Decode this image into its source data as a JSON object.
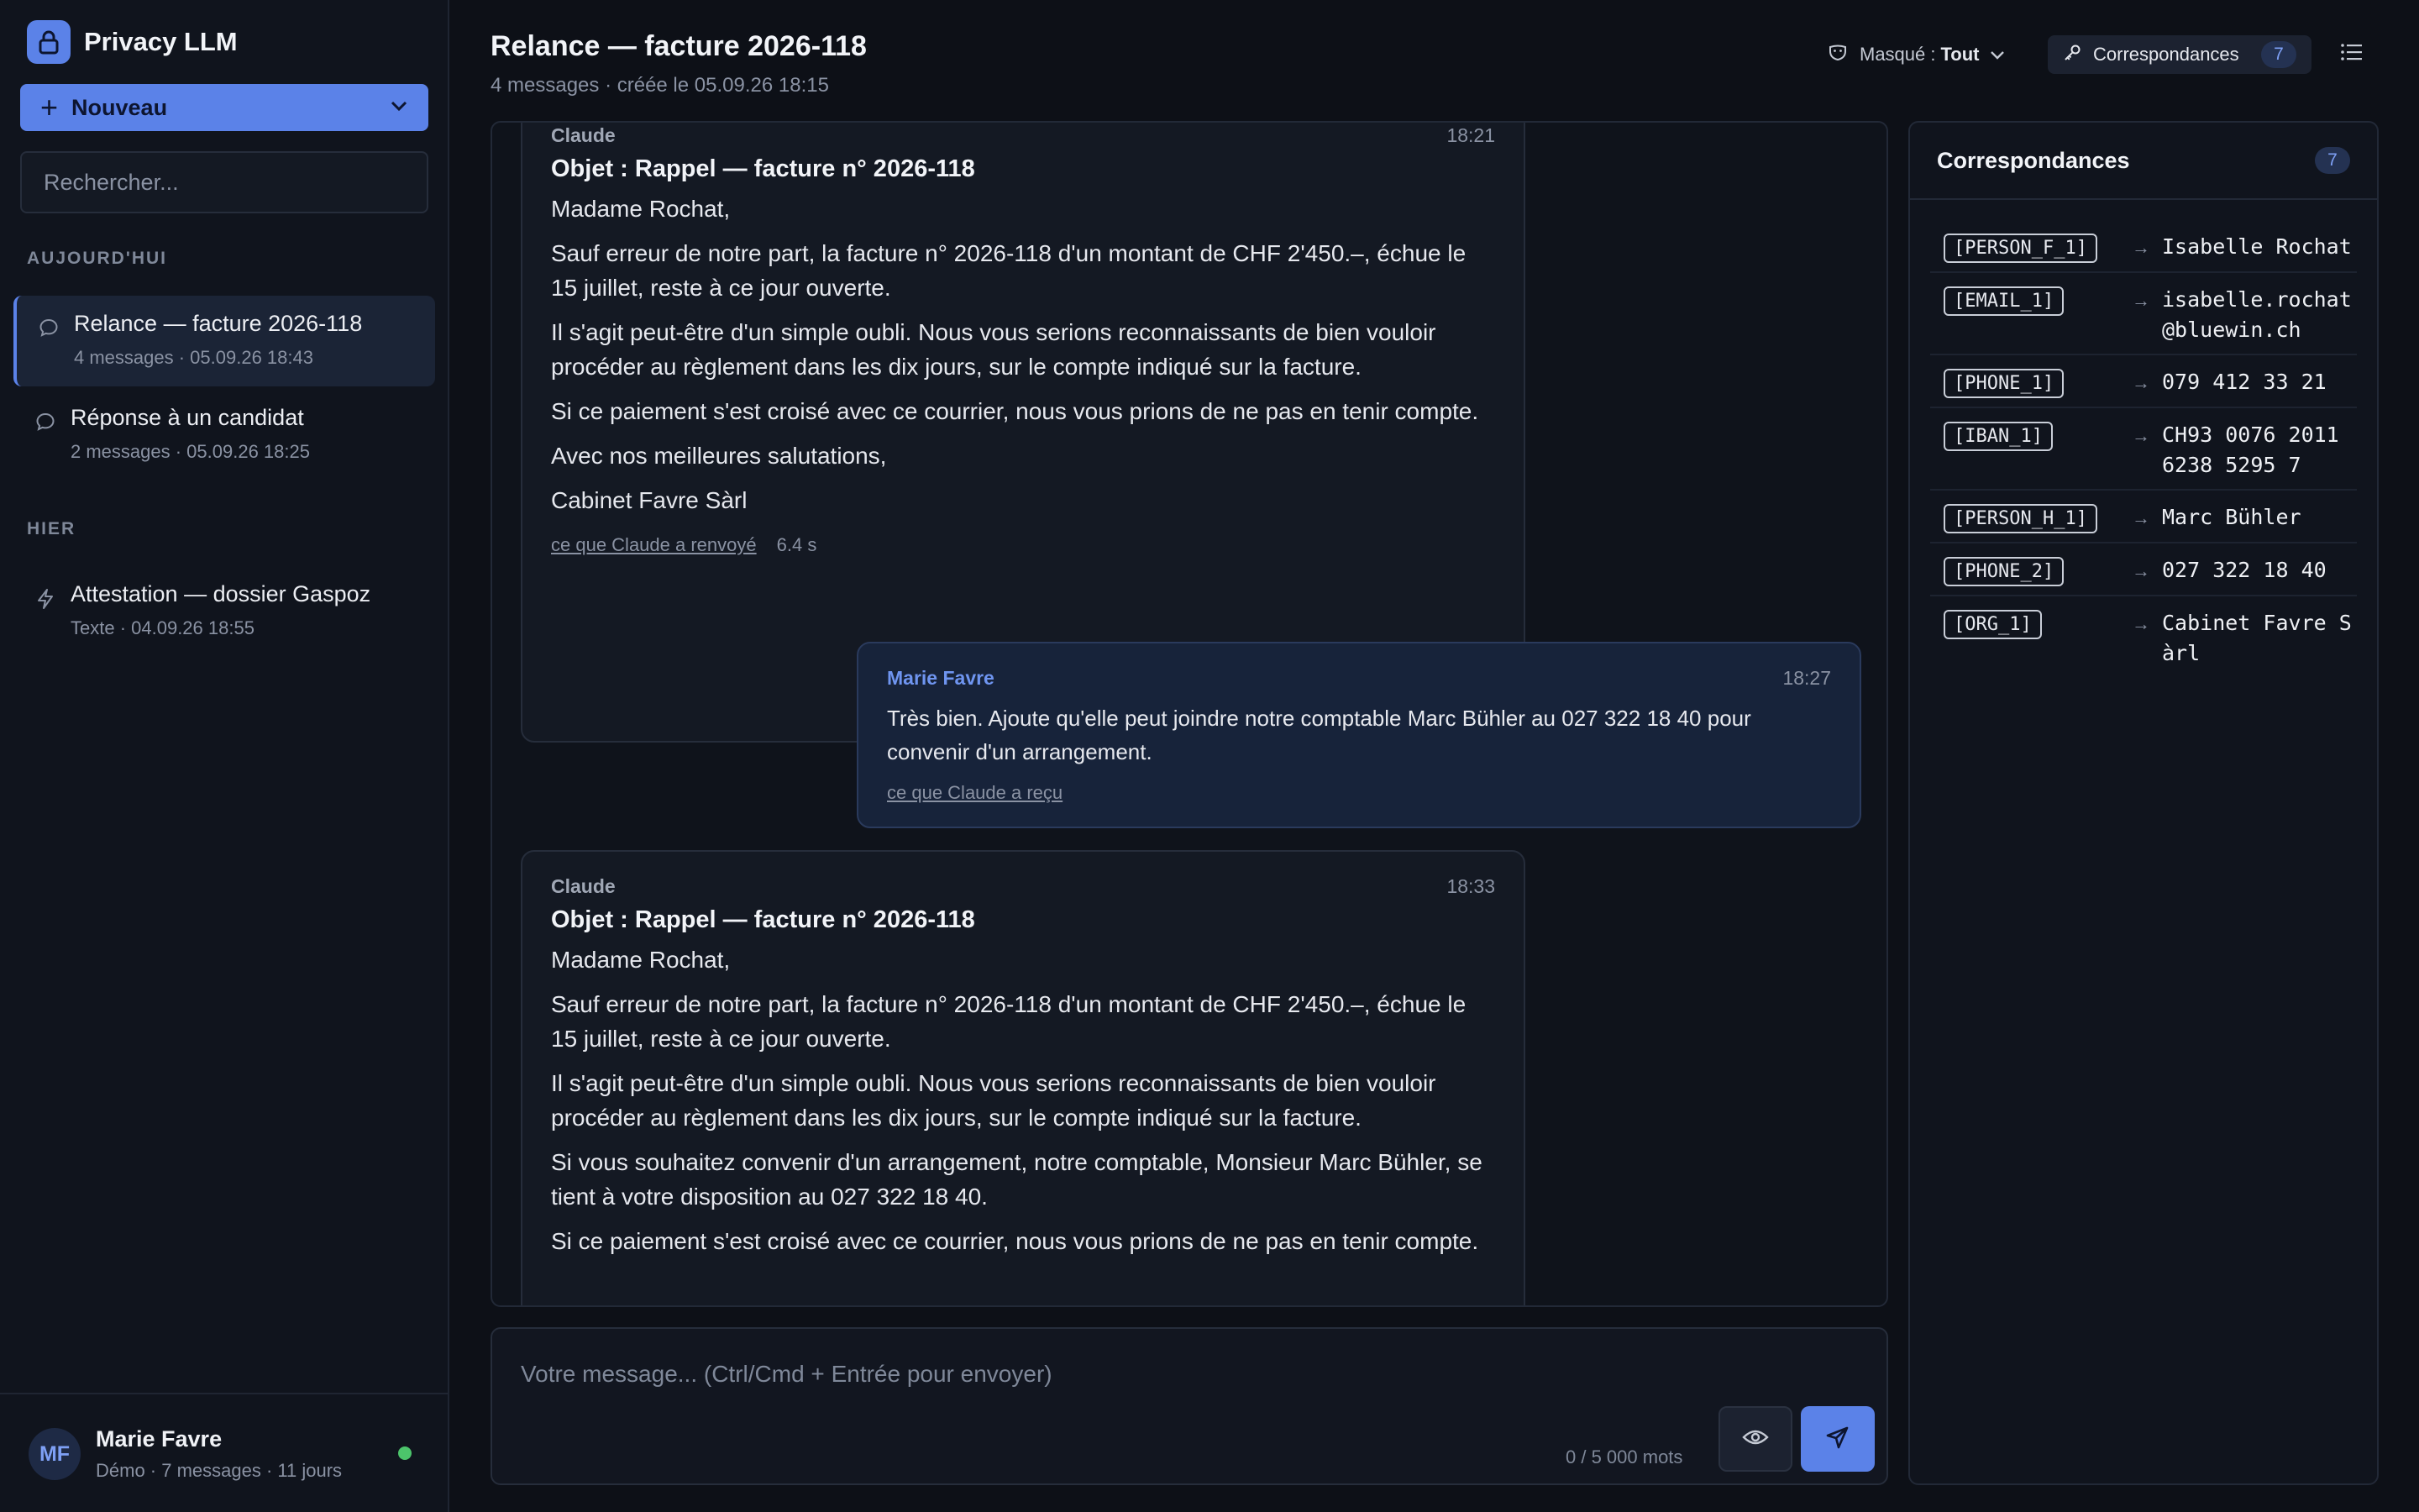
{
  "app": {
    "name": "Privacy LLM"
  },
  "sidebar": {
    "new_label": "Nouveau",
    "search_placeholder": "Rechercher...",
    "sections": {
      "today": "AUJOURD'HUI",
      "yesterday": "HIER"
    },
    "conversations": [
      {
        "title": "Relance — facture 2026-118",
        "meta": "4 messages · 05.09.26 18:43",
        "active": true,
        "icon": "chat-bubble-icon"
      },
      {
        "title": "Réponse à un candidat",
        "meta": "2 messages · 05.09.26 18:25",
        "active": false,
        "icon": "chat-bubble-icon"
      },
      {
        "title": "Attestation — dossier Gaspoz",
        "meta": "Texte · 04.09.26 18:55",
        "active": false,
        "icon": "lightning-icon"
      }
    ],
    "user": {
      "initials": "MF",
      "name": "Marie Favre",
      "meta": "Démo · 7 messages · 11 jours",
      "status_color": "#4cc46b"
    }
  },
  "header": {
    "title": "Relance — facture 2026-118",
    "subtitle": "4 messages · créée le 05.09.26 18:15",
    "mask_label": "Masqué :",
    "mask_value": "Tout",
    "correspondences_label": "Correspondances",
    "correspondences_count": "7"
  },
  "messages": [
    {
      "role": "assistant",
      "author": "Claude",
      "time": "18:21",
      "subject": "Objet : Rappel — facture n° 2026-118",
      "paragraphs": [
        "Madame Rochat,",
        "Sauf erreur de notre part, la facture n° 2026-118 d'un montant de CHF 2'450.–, échue le 15 juillet, reste à ce jour ouverte.",
        "Il s'agit peut-être d'un simple oubli. Nous vous serions reconnaissants de bien vouloir procéder au règlement dans les dix jours, sur le compte indiqué sur la facture.",
        "Si ce paiement s'est croisé avec ce courrier, nous vous prions de ne pas en tenir compte.",
        "Avec nos meilleures salutations,",
        "Cabinet Favre Sàrl"
      ],
      "footer_link": "ce que Claude a renvoyé",
      "duration": "6.4 s"
    },
    {
      "role": "user",
      "author": "Marie Favre",
      "time": "18:27",
      "paragraphs": [
        "Très bien. Ajoute qu'elle peut joindre notre comptable Marc Bühler au 027 322 18 40 pour convenir d'un arrangement."
      ],
      "footer_link": "ce que Claude a reçu"
    },
    {
      "role": "assistant",
      "author": "Claude",
      "time": "18:33",
      "subject": "Objet : Rappel — facture n° 2026-118",
      "paragraphs": [
        "Madame Rochat,",
        "Sauf erreur de notre part, la facture n° 2026-118 d'un montant de CHF 2'450.–, échue le 15 juillet, reste à ce jour ouverte.",
        "Il s'agit peut-être d'un simple oubli. Nous vous serions reconnaissants de bien vouloir procéder au règlement dans les dix jours, sur le compte indiqué sur la facture.",
        "Si vous souhaitez convenir d'un arrangement, notre comptable, Monsieur Marc Bühler, se tient à votre disposition au 027 322 18 40.",
        "Si ce paiement s'est croisé avec ce courrier, nous vous prions de ne pas en tenir compte."
      ]
    }
  ],
  "composer": {
    "placeholder": "Votre message... (Ctrl/Cmd + Entrée pour envoyer)",
    "word_count": "0 / 5 000 mots"
  },
  "correspondences": {
    "title": "Correspondances",
    "count": "7",
    "items": [
      {
        "token": "[PERSON_F_1]",
        "value": "Isabelle Rochat"
      },
      {
        "token": "[EMAIL_1]",
        "value": "isabelle.rochat@bluewin.ch"
      },
      {
        "token": "[PHONE_1]",
        "value": "079 412 33 21"
      },
      {
        "token": "[IBAN_1]",
        "value": "CH93 0076 2011 6238 5295 7"
      },
      {
        "token": "[PERSON_H_1]",
        "value": "Marc Bühler"
      },
      {
        "token": "[PHONE_2]",
        "value": "027 322 18 40"
      },
      {
        "token": "[ORG_1]",
        "value": "Cabinet Favre Sàrl"
      }
    ]
  },
  "colors": {
    "accent": "#5b82e8",
    "background": "#0d1017",
    "online": "#4cc46b"
  }
}
